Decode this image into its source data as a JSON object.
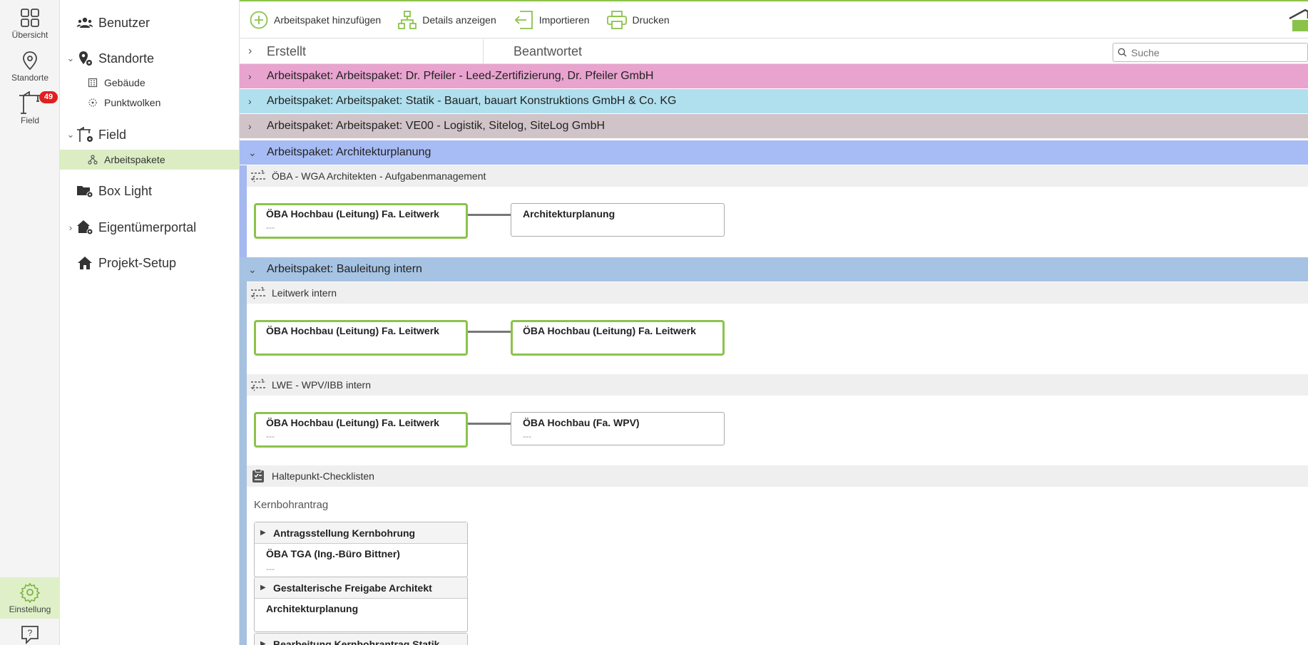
{
  "rail": {
    "overview_label": "Übersicht",
    "locations_label": "Standorte",
    "field_label": "Field",
    "field_badge": "49",
    "settings_label": "Einstellung"
  },
  "nav": {
    "users": "Benutzer",
    "locations": "Standorte",
    "buildings": "Gebäude",
    "point_clouds": "Punktwolken",
    "field": "Field",
    "work_packages": "Arbeitspakete",
    "box_light": "Box Light",
    "owner_portal": "Eigentümerportal",
    "project_setup": "Projekt-Setup"
  },
  "toolbar": {
    "add_label": "Arbeitspaket hinzufügen",
    "details_label": "Details anzeigen",
    "import_label": "Importieren",
    "print_label": "Drucken"
  },
  "columns": {
    "created": "Erstellt",
    "answered": "Beantwortet"
  },
  "search": {
    "placeholder": "Suche"
  },
  "work_packages": [
    {
      "label": "Arbeitspaket: Arbeitspaket: Dr. Pfeiler - Leed-Zertifizierung, Dr. Pfeiler GmbH",
      "color": "#e9a3cf"
    },
    {
      "label": "Arbeitspaket: Arbeitspaket: Statik - Bauart, bauart Konstruktions GmbH & Co. KG",
      "color": "#b0dfee"
    },
    {
      "label": "Arbeitspaket: Arbeitspaket: VE00 - Logistik, Sitelog, SiteLog GmbH",
      "color": "#d0c4c8"
    },
    {
      "label": "Arbeitspaket: Architekturplanung",
      "color": "#a7bcf4"
    },
    {
      "label": "Arbeitspaket: Bauleitung intern",
      "color": "#a6c3e3"
    }
  ],
  "sections": {
    "s1_title": "ÖBA - WGA Architekten - Aufgabenmanagement",
    "s1_from": "ÖBA Hochbau (Leitung) Fa. Leitwerk",
    "s1_from_dots": "---",
    "s1_to": "Architekturplanung",
    "s2_title": "Leitwerk intern",
    "s2_from": "ÖBA Hochbau (Leitung) Fa. Leitwerk",
    "s2_to": "ÖBA Hochbau (Leitung) Fa. Leitwerk",
    "s3_title": "LWE - WPV/IBB intern",
    "s3_from": "ÖBA Hochbau (Leitung) Fa. Leitwerk",
    "s3_from_dots": "---",
    "s3_to": "ÖBA Hochbau (Fa. WPV)",
    "s3_to_dots": "---",
    "s4_title": "Haltepunkt-Checklisten"
  },
  "checklist": {
    "group_label": "Kernbohrantrag",
    "items": [
      {
        "title": "Antragsstellung Kernbohrung",
        "assignee": "ÖBA TGA (Ing.-Büro Bittner)",
        "dots": "---"
      },
      {
        "title": "Gestalterische Freigabe Architekt",
        "assignee": "Architekturplanung",
        "dots": ""
      },
      {
        "title": "Bearbeitung Kernbohrantrag Statik",
        "assignee": "",
        "dots": ""
      }
    ]
  },
  "colors": {
    "accent_green": "#8bc34a",
    "badge_red": "#e02020",
    "active_nav": "#dcedc4"
  }
}
